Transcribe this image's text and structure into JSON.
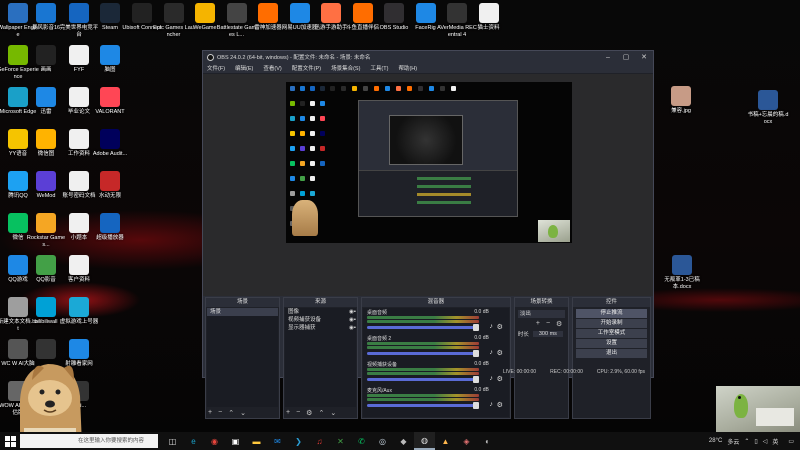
{
  "desktop": {
    "icons_col1": [
      {
        "label": "Wallpaper Engine",
        "icon": "wallpaper-engine-icon",
        "color": "#2a6fbf"
      },
      {
        "label": "GeForce Experience",
        "icon": "geforce-icon",
        "color": "#76b900"
      },
      {
        "label": "Microsoft Edge",
        "icon": "edge-icon",
        "color": "#1aa0c8"
      },
      {
        "label": "YY语音",
        "icon": "yy-icon",
        "color": "#f5c400"
      },
      {
        "label": "腾讯QQ",
        "icon": "qq-icon",
        "color": "#1da1f2"
      },
      {
        "label": "微信",
        "icon": "wechat-icon",
        "color": "#07c160"
      },
      {
        "label": "QQ游戏",
        "icon": "qq-game-icon",
        "color": "#1e88e5"
      },
      {
        "label": "新建文本文档.bat",
        "icon": "bat-file-icon",
        "color": "#9e9e9e"
      },
      {
        "label": "WC W AI大脑",
        "icon": "app-icon",
        "color": "#555555"
      },
      {
        "label": "WOW AI大脑评估版",
        "icon": "app-icon",
        "color": "#666666"
      }
    ],
    "icons_col2": [
      {
        "label": "暴风影音16",
        "icon": "baofeng-icon",
        "color": "#1976d2"
      },
      {
        "label": "画画",
        "icon": "paint-icon",
        "color": "#222222"
      },
      {
        "label": "迅雷",
        "icon": "xunlei-icon",
        "color": "#1e88e5"
      },
      {
        "label": "微信图",
        "icon": "wechat-pic-icon",
        "color": "#ffb300"
      },
      {
        "label": "WeMod",
        "icon": "wemod-icon",
        "color": "#5b3fd6"
      },
      {
        "label": "Rockstar Games...",
        "icon": "rockstar-icon",
        "color": "#f5a623"
      },
      {
        "label": "QQ影音",
        "icon": "qq-player-icon",
        "color": "#43a047"
      },
      {
        "label": "bilibiliwall",
        "icon": "bilibili-icon",
        "color": "#00a1d6"
      },
      {
        "label": "",
        "icon": "app-icon",
        "color": "#333333"
      }
    ],
    "icons_col3": [
      {
        "label": "完美世界电竞平台",
        "icon": "perfect-world-icon",
        "color": "#1565c0"
      },
      {
        "label": "FYF",
        "icon": "doc-icon",
        "color": "#f0f0f0"
      },
      {
        "label": "毕业论文",
        "icon": "doc-icon",
        "color": "#f0f0f0"
      },
      {
        "label": "工作资料",
        "icon": "doc-icon",
        "color": "#f0f0f0"
      },
      {
        "label": "账号密码文档",
        "icon": "doc-icon",
        "color": "#f0f0f0"
      },
      {
        "label": "小题本",
        "icon": "doc-icon",
        "color": "#f0f0f0"
      },
      {
        "label": "客户资料",
        "icon": "doc-icon",
        "color": "#f0f0f0"
      },
      {
        "label": "虚拟游戏上号器",
        "icon": "game-tool-icon",
        "color": "#1ba9d6"
      },
      {
        "label": "射雕看家网",
        "icon": "app-icon",
        "color": "#1e88e5"
      },
      {
        "label": "Frai...",
        "icon": "app-icon",
        "color": "#333333"
      }
    ],
    "icons_col4": [
      {
        "label": "Steam",
        "icon": "steam-icon",
        "color": "#1b2838"
      },
      {
        "label": "脑图",
        "icon": "mindmap-icon",
        "color": "#1e88e5"
      },
      {
        "label": "VALORANT",
        "icon": "valorant-icon",
        "color": "#ff4655"
      },
      {
        "label": "Adobe Audit...",
        "icon": "adobe-audition-icon",
        "color": "#00005b"
      },
      {
        "label": "水动无限",
        "icon": "app-icon",
        "color": "#c62828"
      },
      {
        "label": "超级播放器",
        "icon": "app-icon",
        "color": "#1565c0"
      }
    ],
    "top_row": [
      {
        "label": "Ubisoft Connect",
        "icon": "ubisoft-icon",
        "color": "#222222"
      },
      {
        "label": "Epic Games Launcher",
        "icon": "epic-icon",
        "color": "#2a2a2a"
      },
      {
        "label": "WeGame",
        "icon": "wegame-icon",
        "color": "#f5b400"
      },
      {
        "label": "Battlestate Games L...",
        "icon": "battlestate-icon",
        "color": "#444444"
      },
      {
        "label": "雷神加速器",
        "icon": "leishen-icon",
        "color": "#ff6d00"
      },
      {
        "label": "网易UU加速器",
        "icon": "uu-icon",
        "color": "#1e88e5"
      },
      {
        "label": "迅游手游助手",
        "icon": "xunyou-icon",
        "color": "#ff7043"
      },
      {
        "label": "斗鱼直播伴侣",
        "icon": "douyu-icon",
        "color": "#ff6d00"
      },
      {
        "label": "OBS Studio",
        "icon": "obs-icon",
        "color": "#302e31"
      },
      {
        "label": "FaceRig",
        "icon": "facerig-icon",
        "color": "#1e88e5"
      },
      {
        "label": "AVerMedia RECentral 4",
        "icon": "avermedia-icon",
        "color": "#333333"
      },
      {
        "label": "猫士资料",
        "icon": "doc-icon",
        "color": "#f0f0f0"
      }
    ],
    "right_icons": [
      {
        "label": "兼容.jpg",
        "icon": "image-file-icon",
        "color": "#c79b86"
      },
      {
        "label": "书稿+忘晨的稿.docx",
        "icon": "word-doc-icon",
        "color": "#2b5797"
      },
      {
        "label": "无叛革1-3已稿本.docx",
        "icon": "word-doc-icon",
        "color": "#2b5797"
      }
    ]
  },
  "obs": {
    "title": "OBS 24.0.2 (64-bit, windows) - 配置文件: 未命名 - 场景: 未命名",
    "menu": [
      "文件(F)",
      "编辑(E)",
      "查看(V)",
      "配置文件(P)",
      "场景集合(S)",
      "工具(T)",
      "帮助(H)"
    ],
    "docks": {
      "scenes": {
        "title": "场景",
        "items": [
          "场景"
        ]
      },
      "sources": {
        "title": "来源",
        "items": [
          "图像",
          "视频捕获设备",
          "显示器捕获"
        ]
      },
      "mixer": {
        "title": "混音器",
        "channels": [
          {
            "name": "桌面音频",
            "db": "0.0 dB"
          },
          {
            "name": "桌面音频 2",
            "db": "0.0 dB"
          },
          {
            "name": "视频捕获设备",
            "db": "0.0 dB"
          },
          {
            "name": "麦克风/Aux",
            "db": "0.0 dB"
          }
        ]
      },
      "transitions": {
        "title": "场景转换",
        "type": "淡出",
        "duration_label": "时长",
        "duration": "300 ms"
      },
      "controls": {
        "title": "控件",
        "buttons": [
          "停止推流",
          "开始录制",
          "工作室模式",
          "设置",
          "退出"
        ]
      }
    },
    "status": {
      "live": "LIVE: 00:00:00",
      "rec": "REC: 00:00:00",
      "cpu": "CPU: 2.9%, 60.00 fps"
    }
  },
  "taskbar": {
    "search_placeholder": "在这里输入你要搜索的内容",
    "apps": [
      {
        "icon": "task-view-icon",
        "glyph": "◫",
        "color": "#dddddd"
      },
      {
        "icon": "edge-icon",
        "glyph": "e",
        "color": "#1aa0c8"
      },
      {
        "icon": "chrome-icon",
        "glyph": "◉",
        "color": "#e8453c"
      },
      {
        "icon": "store-icon",
        "glyph": "▣",
        "color": "#ffffff"
      },
      {
        "icon": "file-explorer-icon",
        "glyph": "▬",
        "color": "#ffc83d"
      },
      {
        "icon": "mail-icon",
        "glyph": "✉",
        "color": "#1e88e5"
      },
      {
        "icon": "vscode-icon",
        "glyph": "❯",
        "color": "#2a9fd6"
      },
      {
        "icon": "netease-music-icon",
        "glyph": "♫",
        "color": "#e53935"
      },
      {
        "icon": "xbox-icon",
        "glyph": "✕",
        "color": "#43a047"
      },
      {
        "icon": "wechat-icon",
        "glyph": "✆",
        "color": "#07c160"
      },
      {
        "icon": "steam-icon",
        "glyph": "◎",
        "color": "#c7d5e0"
      },
      {
        "icon": "game-icon",
        "glyph": "◆",
        "color": "#bbbbbb"
      },
      {
        "icon": "obs-icon",
        "glyph": "◍",
        "color": "#e0e0e0",
        "running": true
      },
      {
        "icon": "photos-icon",
        "glyph": "▲",
        "color": "#ffb74d"
      },
      {
        "icon": "app-icon",
        "glyph": "◈",
        "color": "#e57373"
      },
      {
        "icon": "media-icon",
        "glyph": "◐",
        "color": "#bbbbbb"
      }
    ],
    "weather": "28°C",
    "weather_desc": "多云",
    "ime": "英",
    "time": "",
    "date": ""
  }
}
